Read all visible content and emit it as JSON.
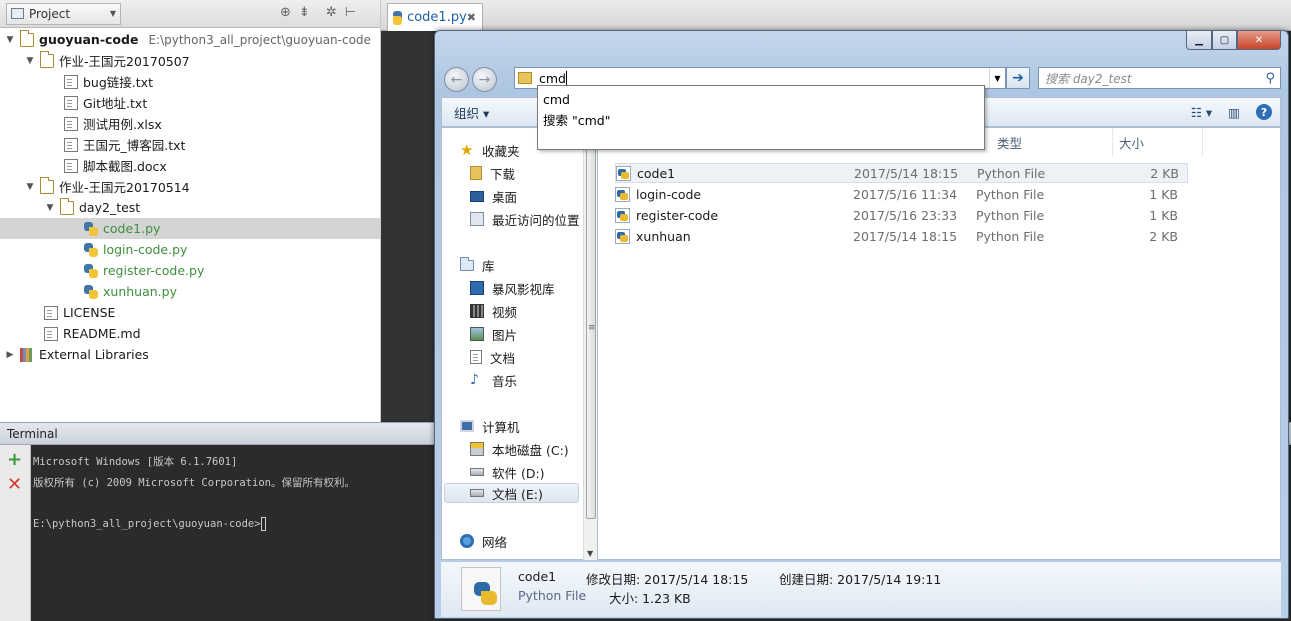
{
  "project": {
    "selector_label": "Project",
    "tree": [
      {
        "label": "guoyuan-code",
        "path": "E:\\python3_all_project\\guoyuan-code",
        "kind": "root"
      },
      {
        "label": "作业-王国元20170507",
        "kind": "folder"
      },
      {
        "label": "bug链接.txt",
        "kind": "file"
      },
      {
        "label": "Git地址.txt",
        "kind": "file"
      },
      {
        "label": "测试用例.xlsx",
        "kind": "file"
      },
      {
        "label": "王国元_博客园.txt",
        "kind": "file"
      },
      {
        "label": "脚本截图.docx",
        "kind": "file"
      },
      {
        "label": "作业-王国元20170514",
        "kind": "folder"
      },
      {
        "label": "day2_test",
        "kind": "folder"
      },
      {
        "label": "code1.py",
        "kind": "py"
      },
      {
        "label": "login-code.py",
        "kind": "py"
      },
      {
        "label": "register-code.py",
        "kind": "py"
      },
      {
        "label": "xunhuan.py",
        "kind": "py"
      },
      {
        "label": "LICENSE",
        "kind": "file"
      },
      {
        "label": "README.md",
        "kind": "file"
      },
      {
        "label": "External Libraries",
        "kind": "lib"
      }
    ]
  },
  "editor": {
    "active_tab": "code1.py"
  },
  "terminal": {
    "title": "Terminal",
    "lines": [
      "Microsoft Windows [版本 6.1.7601]",
      "版权所有 (c) 2009 Microsoft Corporation。保留所有权利。",
      "",
      "E:\\python3_all_project\\guoyuan-code>"
    ]
  },
  "explorer": {
    "address_value": "cmd",
    "search_placeholder": "搜索 day2_test",
    "organize_label": "组织 ▾",
    "autocomplete": [
      "cmd",
      "搜索 \"cmd\""
    ],
    "nav": {
      "favorites": {
        "title": "收藏夹",
        "items": [
          "下载",
          "桌面",
          "最近访问的位置"
        ]
      },
      "libraries": {
        "title": "库",
        "items": [
          "暴风影视库",
          "视频",
          "图片",
          "文档",
          "音乐"
        ]
      },
      "computer": {
        "title": "计算机",
        "items": [
          "本地磁盘 (C:)",
          "软件 (D:)",
          "文档 (E:)"
        ]
      },
      "network": "网络"
    },
    "columns": {
      "type": "类型",
      "size": "大小"
    },
    "files": [
      {
        "name": "code1",
        "date": "2017/5/14 18:15",
        "type": "Python File",
        "size": "2 KB"
      },
      {
        "name": "login-code",
        "date": "2017/5/16 11:34",
        "type": "Python File",
        "size": "1 KB"
      },
      {
        "name": "register-code",
        "date": "2017/5/16 23:33",
        "type": "Python File",
        "size": "1 KB"
      },
      {
        "name": "xunhuan",
        "date": "2017/5/14 18:15",
        "type": "Python File",
        "size": "2 KB"
      }
    ],
    "details": {
      "name": "code1",
      "type": "Python File",
      "modified": "修改日期: 2017/5/14 18:15",
      "created": "创建日期: 2017/5/14 19:11",
      "size": "大小: 1.23 KB"
    }
  }
}
